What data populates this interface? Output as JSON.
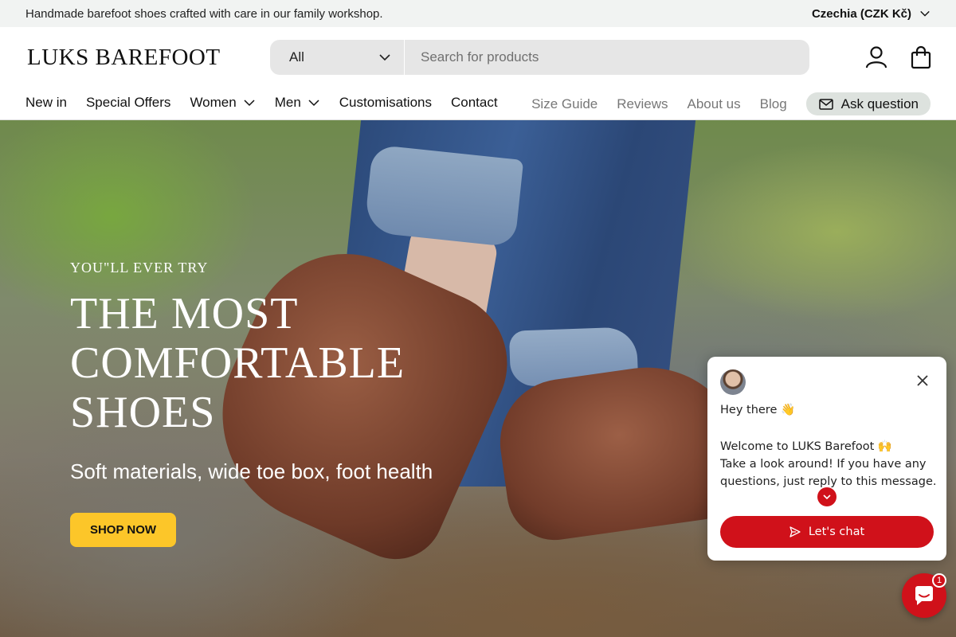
{
  "topbar": {
    "announcement": "Handmade barefoot shoes crafted with care in our family workshop.",
    "country": "Czechia (CZK Kč)"
  },
  "header": {
    "logo": "LUKS BAREFOOT",
    "search_category": "All",
    "search_placeholder": "Search for products",
    "account_icon": "user-icon",
    "cart_icon": "bag-icon"
  },
  "nav": {
    "primary": [
      {
        "label": "New in"
      },
      {
        "label": "Special Offers"
      },
      {
        "label": "Women"
      },
      {
        "label": "Men"
      },
      {
        "label": "Customisations"
      },
      {
        "label": "Contact"
      }
    ],
    "secondary": [
      {
        "label": "Size Guide"
      },
      {
        "label": "Reviews"
      },
      {
        "label": "About us"
      },
      {
        "label": "Blog"
      }
    ],
    "ask_question": "Ask question"
  },
  "hero": {
    "eyebrow": "YOU\"LL EVER TRY",
    "title": "THE MOST COMFORTABLE SHOES",
    "subtitle": "Soft materials, wide toe box, foot health",
    "cta": "SHOP NOW"
  },
  "chat": {
    "greeting": "Hey there 👋",
    "welcome": "Welcome to LUKS Barefoot 🙌",
    "message": "Take a look around! If you have any questions, just reply to this message.",
    "button": "Let's chat",
    "unread_count": "1"
  },
  "colors": {
    "accent_red": "#d0111a",
    "cta_yellow": "#fcc629",
    "topbar_bg": "#f1f3f2"
  }
}
